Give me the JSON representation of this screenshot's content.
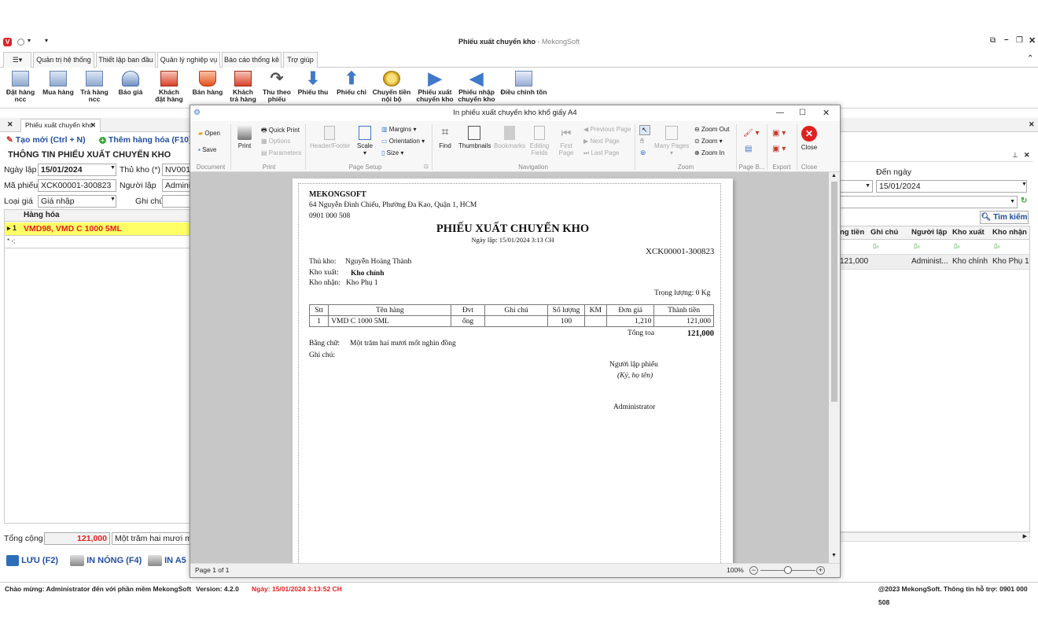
{
  "app": {
    "title": "Phiếu xuất chuyển kho",
    "brand": "MekongSoft",
    "title_sep": " - "
  },
  "menu_tabs": [
    "Quản trị hệ thống",
    "Thiết lập ban đầu",
    "Quản lý nghiệp vụ",
    "Báo cáo thống kê",
    "Trợ giúp"
  ],
  "ribbon": [
    "Đặt hàng\nncc",
    "Mua hàng",
    "Trả hàng\nncc",
    "Báo giá",
    "Khách\nđặt hàng",
    "Bán hàng",
    "Khách\ntrả hàng",
    "Thu theo\nphiếu",
    "Phiếu thu",
    "Phiếu chi",
    "Chuyển tiền\nnội bộ",
    "Phiếu xuất\nchuyển kho",
    "Phiếu nhập\nchuyển kho",
    "Điều chỉnh tồn"
  ],
  "doc_tab": "Phiếu xuất chuyển kho",
  "toolbar": {
    "new": "Tạo mới (Ctrl + N)",
    "add_goods": "Thêm hàng hóa (F10)"
  },
  "form": {
    "section_title": "THÔNG TIN PHIẾU XUẤT CHUYỂN KHO",
    "date_label": "Ngày lập",
    "date_value": "15/01/2024",
    "keeper_label": "Thủ kho (*)",
    "keeper_value": "NV001,",
    "code_label": "Mã phiếu",
    "code_value": "XCK00001-300823",
    "creator_label": "Người lập",
    "creator_value": "Adminis",
    "price_label": "Loại giá",
    "price_value": "Giá nhập",
    "note_label": "Ghi chú",
    "grid_header": "Hàng hóa",
    "grid_row_num": "1",
    "grid_row_item": "VMD98, VMD C 1000 5ML",
    "grid_new_row": "* -;"
  },
  "footer": {
    "total_label": "Tổng cộng",
    "total_value": "121,000",
    "words": "Một trăm hai mươi mốt",
    "save": "LƯU (F2)",
    "print_hot": "IN NÓNG (F4)",
    "print_a5": "IN A5"
  },
  "right_panel": {
    "to_date_label": "Đến ngày",
    "to_date_value": "15/01/2024",
    "search": "Tìm kiếm",
    "headers": [
      "ng tiền",
      "Ghi chú",
      "Người lập",
      "Kho xuất",
      "Kho nhận"
    ],
    "row": [
      "121,000",
      "",
      "Administ...",
      "Kho chính",
      "Kho Phụ 1"
    ]
  },
  "status": {
    "welcome": "Chào mừng: Administrator đến với phần mềm MekongSoft",
    "version": "Version: 4.2.0",
    "date": "Ngày: 15/01/2024 3:13:52 CH",
    "copyright": "@2023 MekongSoft. Thông tin hỗ trợ: 0901 000 508"
  },
  "dialog": {
    "title": "In phiếu xuất chuyển kho khổ giấy A4",
    "buttons": {
      "open": "Open",
      "save": "Save",
      "print": "Print",
      "quick_print": "Quick Print",
      "options": "Options",
      "parameters": "Parameters",
      "header_footer": "Header/Footer",
      "scale": "Scale",
      "margins": "Margins",
      "orientation": "Orientation",
      "size": "Size",
      "find": "Find",
      "thumbnails": "Thumbnails",
      "bookmarks": "Bookmarks",
      "editing_fields": "Editing\nFields",
      "first_page": "First\nPage",
      "prev_page": "Previous Page",
      "next_page": "Next Page",
      "last_page": "Last Page",
      "many_pages": "Many Pages",
      "zoom_out": "Zoom Out",
      "zoom": "Zoom",
      "zoom_in": "Zoom In",
      "close": "Close"
    },
    "groups": [
      "Document",
      "Print",
      "Page Setup",
      "Navigation",
      "Zoom",
      "Page B...",
      "Export",
      "Close"
    ],
    "page_status": "Page 1 of 1",
    "zoom_level": "100%"
  },
  "invoice": {
    "company": "MEKONGSOFT",
    "address": "64 Nguyễn Đình Chiểu, Phường Đa Kao, Quận 1, HCM",
    "phone": "0901 000 508",
    "title": "PHIẾU XUẤT CHUYỂN KHO",
    "date_line": "Ngày lập: 15/01/2024  3:13 CH",
    "code": "XCK00001-300823",
    "keeper_label": "Thủ kho:",
    "keeper": "Nguyễn Hoàng Thành",
    "from_label": "Kho xuất:",
    "from": "Kho chính",
    "to_label": "Kho nhận:",
    "to": "Kho Phụ 1",
    "weight": "Trọng lượng: 0 Kg",
    "cols": [
      "Stt",
      "Tên hàng",
      "Đvt",
      "Ghi chú",
      "Số lượng",
      "KM",
      "Đơn giá",
      "Thành tiền"
    ],
    "row": [
      "1",
      "VMD C 1000 5ML",
      "ống",
      "",
      "100",
      "",
      "1,210",
      "121,000"
    ],
    "total_label": "Tổng toa",
    "total": "121,000",
    "words_label": "Bằng chữ:",
    "words": "Một trăm hai mươi mốt nghìn đồng",
    "note_label": "Ghi chú:",
    "signer_title": "Người lập phiếu",
    "signer_sub": "(Ký, họ tên)",
    "signer": "Administrator"
  },
  "colors": {
    "accent": "#1f4e9e",
    "red": "#e02020",
    "highlight": "#ffff66",
    "brand_red": "#d9262c"
  }
}
